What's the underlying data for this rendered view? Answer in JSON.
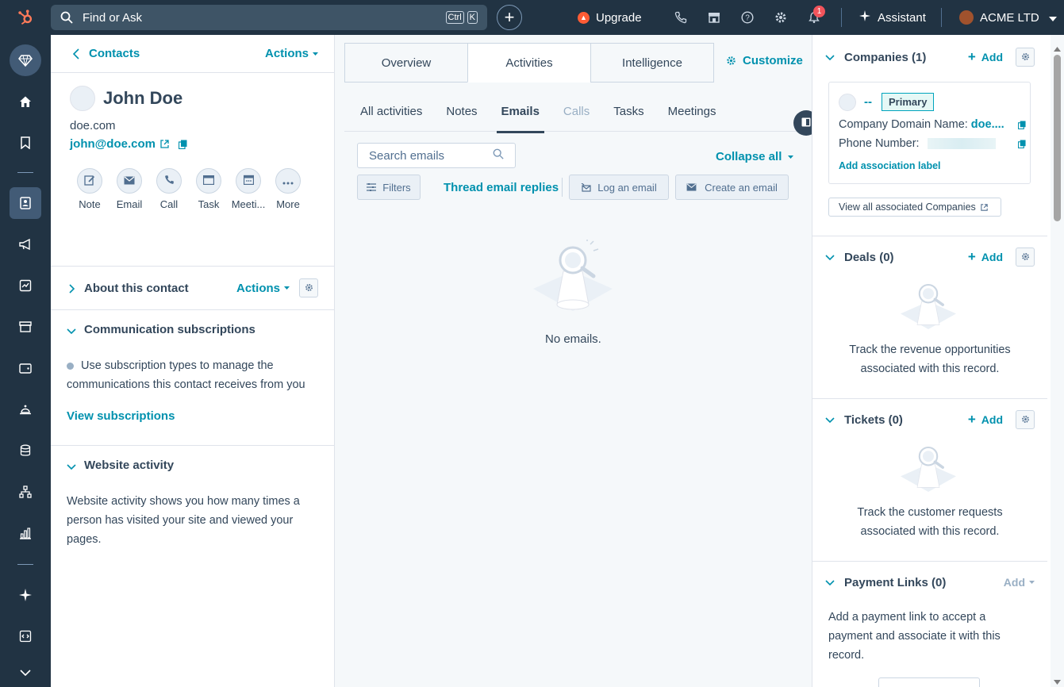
{
  "topbar": {
    "search_placeholder": "Find or Ask",
    "kbd_ctrl": "Ctrl",
    "kbd_k": "K",
    "add": "+",
    "upgrade": "Upgrade",
    "notifications_count": "1",
    "assistant": "Assistant",
    "account": "ACME LTD",
    "icons": [
      "hubspot-logo",
      "search-icon",
      "plus-icon",
      "upgrade-icon",
      "phone-icon",
      "marketplace-icon",
      "help-icon",
      "settings-icon",
      "bell-icon",
      "sparkle-icon",
      "avatar",
      "chevron-down-icon"
    ]
  },
  "leftnav": {
    "icons": [
      "diamond-icon",
      "home-icon",
      "bookmark-icon",
      "contacts-icon",
      "megaphone-icon",
      "sales-icon",
      "commerce-icon",
      "wallet-icon",
      "service-icon",
      "data-icon",
      "automation-icon",
      "reports-icon",
      "sparkle-icon",
      "code-icon",
      "chevron-down-icon"
    ]
  },
  "leftpanel": {
    "back_label": "Contacts",
    "actions_label": "Actions",
    "contact_name": "John Doe",
    "domain": "doe.com",
    "email": "john@doe.com",
    "actions": [
      {
        "label": "Note",
        "icon": "note-icon"
      },
      {
        "label": "Email",
        "icon": "email-icon"
      },
      {
        "label": "Call",
        "icon": "call-icon"
      },
      {
        "label": "Task",
        "icon": "task-icon"
      },
      {
        "label": "Meeti...",
        "icon": "meeting-icon"
      },
      {
        "label": "More",
        "icon": "more-icon"
      }
    ],
    "about": {
      "title": "About this contact",
      "actions_label": "Actions"
    },
    "subscriptions": {
      "title": "Communication subscriptions",
      "text_line1": "Use subscription types to manage the",
      "text_line2": "communications this contact receives from you",
      "link": "View subscriptions"
    },
    "website": {
      "title": "Website activity",
      "line1": "Website activity shows you how many times a",
      "line2": "person has visited your site and viewed your",
      "line3": "pages."
    }
  },
  "center": {
    "tabs": [
      "Overview",
      "Activities",
      "Intelligence"
    ],
    "active_tab": "Activities",
    "customize": "Customize",
    "subtabs": [
      "All activities",
      "Notes",
      "Emails",
      "Calls",
      "Tasks",
      "Meetings"
    ],
    "active_subtab": "Emails",
    "search_placeholder": "Search emails",
    "collapse_all": "Collapse all",
    "filters": "Filters",
    "thread_replies": "Thread email replies",
    "log_email": "Log an email",
    "create_email": "Create an email",
    "empty_text": "No emails."
  },
  "rightpanel": {
    "companies": {
      "title": "Companies (1)",
      "add": "Add",
      "company_name": "--",
      "primary": "Primary",
      "domain_label": "Company Domain Name:",
      "domain_value": "doe....",
      "phone_label": "Phone Number:",
      "assoc_label": "Add association label",
      "view_all": "View all associated Companies"
    },
    "deals": {
      "title": "Deals (0)",
      "add": "Add",
      "line1": "Track the revenue opportunities",
      "line2": "associated with this record."
    },
    "tickets": {
      "title": "Tickets (0)",
      "add": "Add",
      "line1": "Track the customer requests",
      "line2": "associated with this record."
    },
    "payments": {
      "title": "Payment Links (0)",
      "add": "Add",
      "line1": "Add a payment link to accept a",
      "line2": "payment and associate it with this",
      "line3": "record."
    }
  },
  "colors": {
    "nav_bg": "#213343",
    "accent": "#0091ae",
    "text": "#33475b",
    "upgrade": "#ff5c35",
    "badge": "#f2545b"
  }
}
